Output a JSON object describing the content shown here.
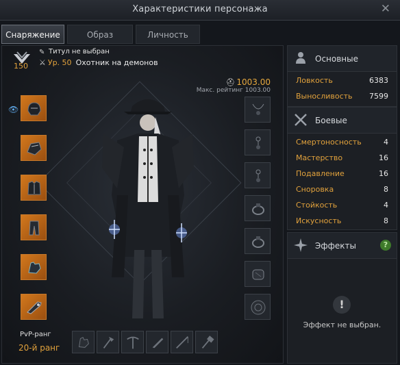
{
  "window": {
    "title": "Характеристики персонажа",
    "close_glyph": "✕"
  },
  "tabs": [
    {
      "label": "Снаряжение",
      "active": true
    },
    {
      "label": "Образ",
      "active": false
    },
    {
      "label": "Личность",
      "active": false
    }
  ],
  "character": {
    "roster_level": "150",
    "title": "Титул не выбран",
    "level": "Ур. 50",
    "class": "Охотник на демонов",
    "item_level": "1003.00",
    "max_rating": "Макс. рейтинг 1003.00",
    "pvp_label": "PvP-ранг",
    "pvp_rank": "20-й ранг"
  },
  "gear_slots": [
    {
      "name": "helmet",
      "icon": "helmet-icon"
    },
    {
      "name": "shoulders",
      "icon": "shoulder-icon"
    },
    {
      "name": "chest",
      "icon": "chest-icon"
    },
    {
      "name": "pants",
      "icon": "pants-icon"
    },
    {
      "name": "gloves",
      "icon": "gloves-icon"
    },
    {
      "name": "weapon",
      "icon": "weapon-icon"
    }
  ],
  "accessory_slots": [
    {
      "name": "necklace",
      "icon": "necklace-icon"
    },
    {
      "name": "earring-1",
      "icon": "earring-icon"
    },
    {
      "name": "earring-2",
      "icon": "earring-icon"
    },
    {
      "name": "ring-1",
      "icon": "ring-icon"
    },
    {
      "name": "ring-2",
      "icon": "ring-icon"
    },
    {
      "name": "bracelet",
      "icon": "bracelet-icon"
    },
    {
      "name": "stone",
      "icon": "stone-icon"
    }
  ],
  "bottom_slots": [
    {
      "name": "life-tool-1",
      "icon": "gloves-tool-icon"
    },
    {
      "name": "life-tool-2",
      "icon": "axe-icon"
    },
    {
      "name": "life-tool-3",
      "icon": "pickaxe-icon"
    },
    {
      "name": "life-tool-4",
      "icon": "knife-icon"
    },
    {
      "name": "life-tool-5",
      "icon": "rod-icon"
    },
    {
      "name": "life-tool-6",
      "icon": "hammer-icon"
    }
  ],
  "basic": {
    "header": "Основные",
    "stats": [
      {
        "name": "Ловкость",
        "value": "6383"
      },
      {
        "name": "Выносливость",
        "value": "7599"
      }
    ]
  },
  "combat": {
    "header": "Боевые",
    "stats": [
      {
        "name": "Смертоносность",
        "value": "4"
      },
      {
        "name": "Мастерство",
        "value": "16"
      },
      {
        "name": "Подавление",
        "value": "16"
      },
      {
        "name": "Сноровка",
        "value": "8"
      },
      {
        "name": "Стойкость",
        "value": "4"
      },
      {
        "name": "Искусность",
        "value": "8"
      }
    ]
  },
  "effects": {
    "header": "Эффекты",
    "help": "?",
    "empty_text": "Эффект не выбран."
  },
  "colors": {
    "accent_orange": "#e2a23c",
    "gear_slot_bg": "#c7701c",
    "help_green": "#3e7a2a"
  }
}
